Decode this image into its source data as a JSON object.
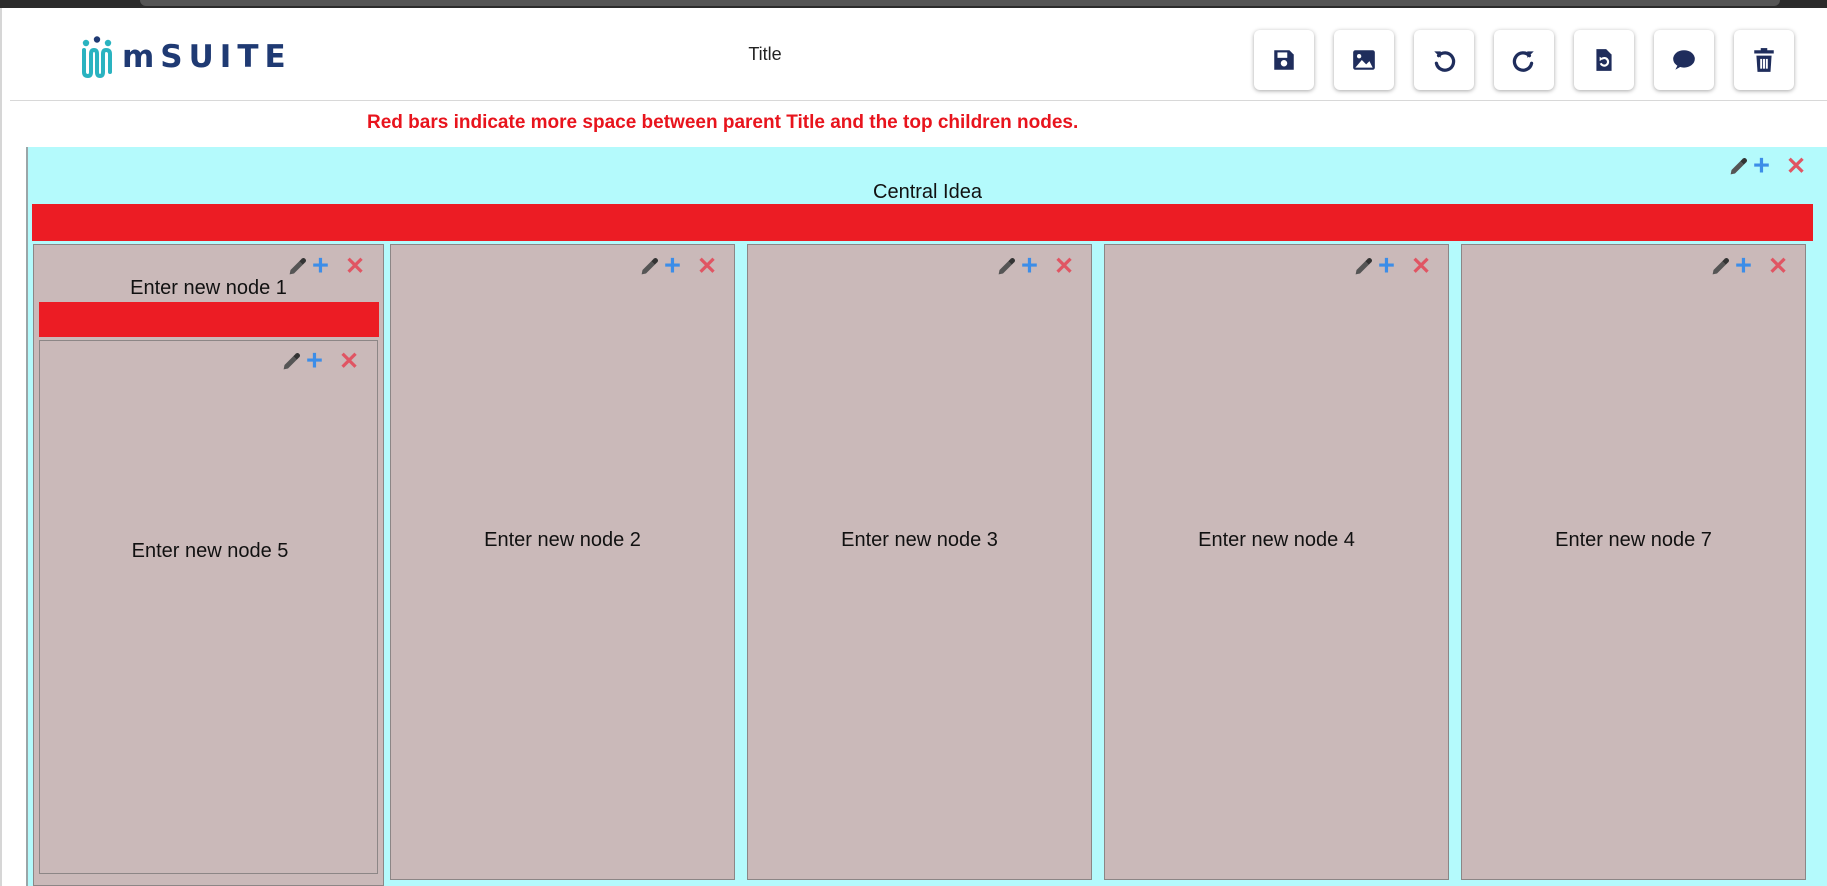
{
  "app": {
    "logo_text": "mSUITE",
    "title": "Title",
    "notice": "Red bars indicate more space between parent Title and the top children nodes."
  },
  "toolbar": {
    "buttons": [
      {
        "name": "save-button",
        "icon": "floppy-disk-icon"
      },
      {
        "name": "image-button",
        "icon": "image-icon"
      },
      {
        "name": "undo-button",
        "icon": "undo-icon"
      },
      {
        "name": "redo-button",
        "icon": "redo-icon"
      },
      {
        "name": "reset-button",
        "icon": "file-reset-icon"
      },
      {
        "name": "chat-button",
        "icon": "speech-bubble-icon"
      },
      {
        "name": "delete-button",
        "icon": "trash-icon"
      }
    ]
  },
  "mindmap": {
    "central": {
      "label": "Central Idea"
    },
    "nodes": [
      {
        "label": "Enter new node 1",
        "children": [
          {
            "label": "Enter new node 5"
          }
        ]
      },
      {
        "label": "Enter new node 2"
      },
      {
        "label": "Enter new node 3"
      },
      {
        "label": "Enter new node 4"
      },
      {
        "label": "Enter new node 7"
      }
    ],
    "controls": {
      "plus": "+",
      "close": "✕"
    }
  },
  "colors": {
    "central_bg": "#b4fafc",
    "node_bg": "#cab9b9",
    "red_bar": "#ec1c24",
    "plus": "#3c8de8",
    "close": "#e05563",
    "toolbar_icon": "#1f2d5c"
  }
}
